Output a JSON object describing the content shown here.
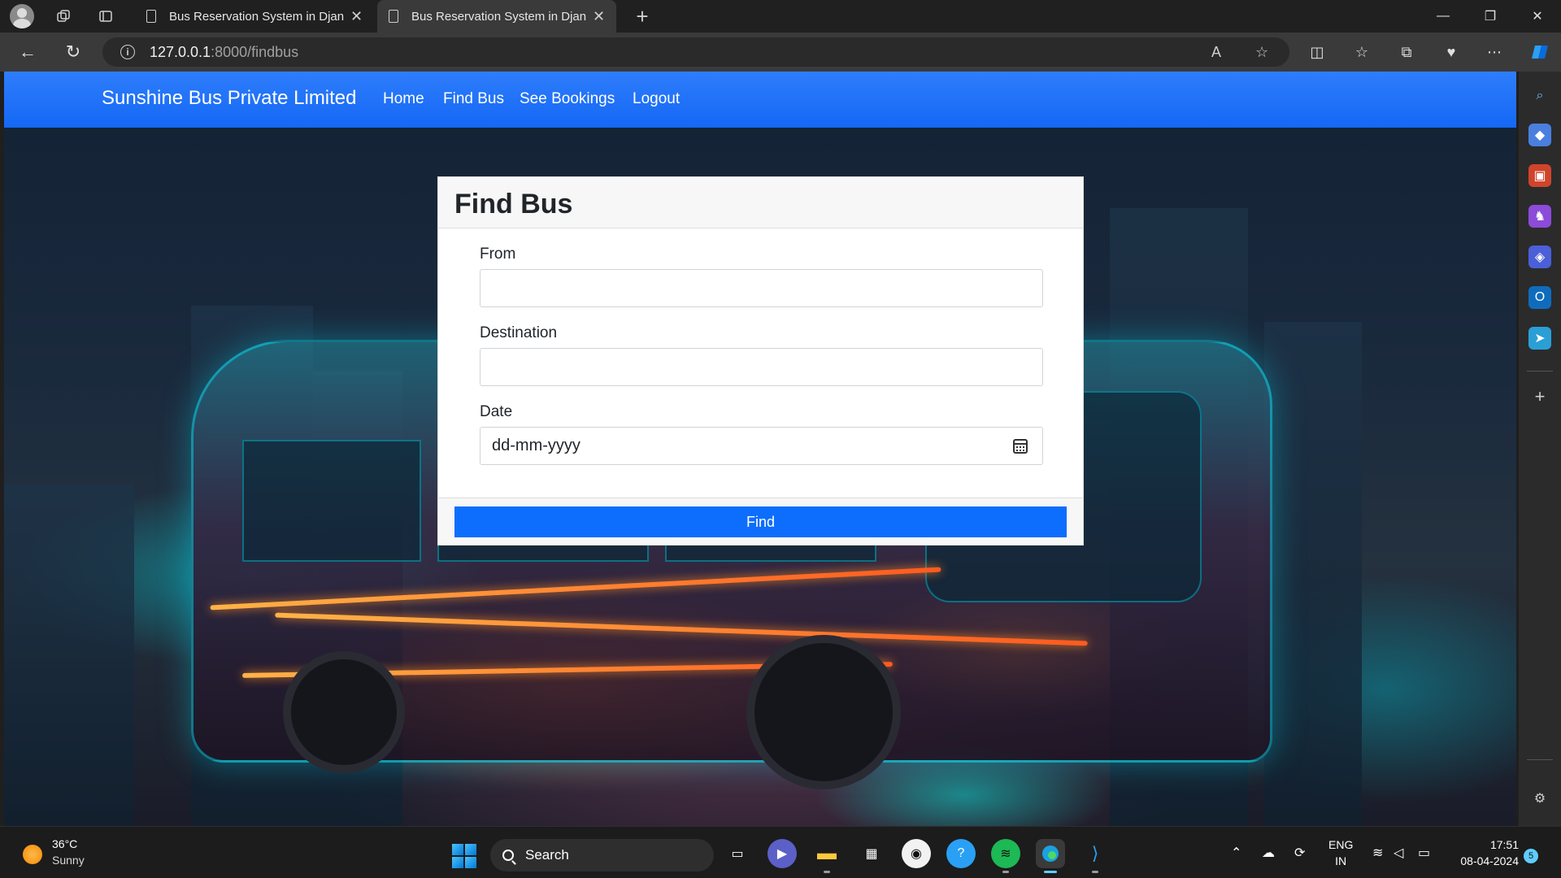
{
  "browser": {
    "tabs": [
      {
        "title": "Bus Reservation System in Django",
        "active": false
      },
      {
        "title": "Bus Reservation System in Django",
        "active": true
      }
    ],
    "url_host": "127.0.0.1",
    "url_path": ":8000/findbus",
    "new_tab_label": "+"
  },
  "site": {
    "brand": "Sunshine Bus Private Limited",
    "nav": [
      "Home",
      "Find Bus",
      "See Bookings",
      "Logout"
    ]
  },
  "form": {
    "title": "Find Bus",
    "from_label": "From",
    "from_value": "",
    "destination_label": "Destination",
    "destination_value": "",
    "date_label": "Date",
    "date_placeholder": "dd-mm-yyyy",
    "submit_label": "Find"
  },
  "taskbar": {
    "weather_temp": "36°C",
    "weather_desc": "Sunny",
    "search_label": "Search",
    "lang_line1": "ENG",
    "lang_line2": "IN",
    "time": "17:51",
    "date": "08-04-2024",
    "notification_count": "5"
  },
  "colors": {
    "navbar": "#1468f5",
    "primary_button": "#0d6efd",
    "chrome_dark": "#202020"
  }
}
